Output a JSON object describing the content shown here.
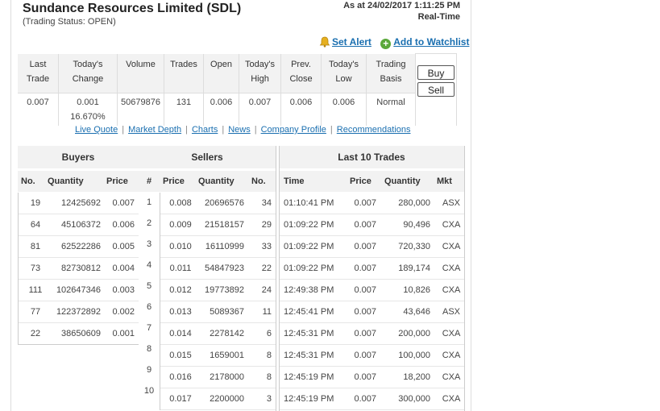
{
  "header": {
    "title": "Sundance Resources Limited (SDL)",
    "trading_status": "(Trading Status: OPEN)",
    "as_at": "As at 24/02/2017 1:11:25 PM",
    "realtime": "Real-Time"
  },
  "actions": {
    "set_alert": "Set Alert",
    "add_watchlist": "Add to Watchlist"
  },
  "quote": {
    "headers": {
      "last_trade": [
        "Last",
        "Trade"
      ],
      "todays_change": [
        "Today's",
        "Change"
      ],
      "volume": "Volume",
      "trades": "Trades",
      "open": "Open",
      "todays_high": [
        "Today's",
        "High"
      ],
      "prev_close": [
        "Prev.",
        "Close"
      ],
      "todays_low": [
        "Today's",
        "Low"
      ],
      "trading_basis": [
        "Trading",
        "Basis"
      ]
    },
    "values": {
      "last_trade": "0.007",
      "change_abs": "0.001",
      "change_pct": "16.670%",
      "volume": "50679876",
      "trades": "131",
      "open": "0.006",
      "high": "0.007",
      "prev_close": "0.006",
      "low": "0.006",
      "basis": "Normal"
    },
    "buy_label": "Buy",
    "sell_label": "Sell"
  },
  "links": [
    "Live Quote",
    "Market Depth",
    "Charts",
    "News",
    "Company Profile",
    "Recommendations"
  ],
  "depth": {
    "buyers_title": "Buyers",
    "sellers_title": "Sellers",
    "trades_title": "Last 10 Trades",
    "buyer_cols": [
      "No.",
      "Quantity",
      "Price"
    ],
    "hash_col": "#",
    "seller_cols": [
      "Price",
      "Quantity",
      "No."
    ],
    "trade_cols": [
      "Time",
      "Price",
      "Quantity",
      "Mkt"
    ],
    "buyers": [
      {
        "no": "19",
        "qty": "12425692",
        "price": "0.007"
      },
      {
        "no": "64",
        "qty": "45106372",
        "price": "0.006"
      },
      {
        "no": "81",
        "qty": "62522286",
        "price": "0.005"
      },
      {
        "no": "73",
        "qty": "82730812",
        "price": "0.004"
      },
      {
        "no": "111",
        "qty": "102647346",
        "price": "0.003"
      },
      {
        "no": "77",
        "qty": "122372892",
        "price": "0.002"
      },
      {
        "no": "22",
        "qty": "38650609",
        "price": "0.001"
      }
    ],
    "levels": [
      "1",
      "2",
      "3",
      "4",
      "5",
      "6",
      "7",
      "8",
      "9",
      "10"
    ],
    "sellers": [
      {
        "price": "0.008",
        "qty": "20696576",
        "no": "34"
      },
      {
        "price": "0.009",
        "qty": "21518157",
        "no": "29"
      },
      {
        "price": "0.010",
        "qty": "16110999",
        "no": "33"
      },
      {
        "price": "0.011",
        "qty": "54847923",
        "no": "22"
      },
      {
        "price": "0.012",
        "qty": "19773892",
        "no": "24"
      },
      {
        "price": "0.013",
        "qty": "5089367",
        "no": "11"
      },
      {
        "price": "0.014",
        "qty": "2278142",
        "no": "6"
      },
      {
        "price": "0.015",
        "qty": "1659001",
        "no": "8"
      },
      {
        "price": "0.016",
        "qty": "2178000",
        "no": "8"
      },
      {
        "price": "0.017",
        "qty": "2200000",
        "no": "3"
      }
    ],
    "trades": [
      {
        "time": "01:10:41 PM",
        "price": "0.007",
        "qty": "280,000",
        "mkt": "ASX"
      },
      {
        "time": "01:09:22 PM",
        "price": "0.007",
        "qty": "90,496",
        "mkt": "CXA"
      },
      {
        "time": "01:09:22 PM",
        "price": "0.007",
        "qty": "720,330",
        "mkt": "CXA"
      },
      {
        "time": "01:09:22 PM",
        "price": "0.007",
        "qty": "189,174",
        "mkt": "CXA"
      },
      {
        "time": "12:49:38 PM",
        "price": "0.007",
        "qty": "10,826",
        "mkt": "CXA"
      },
      {
        "time": "12:45:41 PM",
        "price": "0.007",
        "qty": "43,646",
        "mkt": "ASX"
      },
      {
        "time": "12:45:31 PM",
        "price": "0.007",
        "qty": "200,000",
        "mkt": "CXA"
      },
      {
        "time": "12:45:31 PM",
        "price": "0.007",
        "qty": "100,000",
        "mkt": "CXA"
      },
      {
        "time": "12:45:19 PM",
        "price": "0.007",
        "qty": "18,200",
        "mkt": "CXA"
      },
      {
        "time": "12:45:19 PM",
        "price": "0.007",
        "qty": "300,000",
        "mkt": "CXA"
      }
    ]
  },
  "colors": {
    "link": "#1a6fb0",
    "positive": "#3a9a2a",
    "header_bg": "#f2f2f2"
  }
}
